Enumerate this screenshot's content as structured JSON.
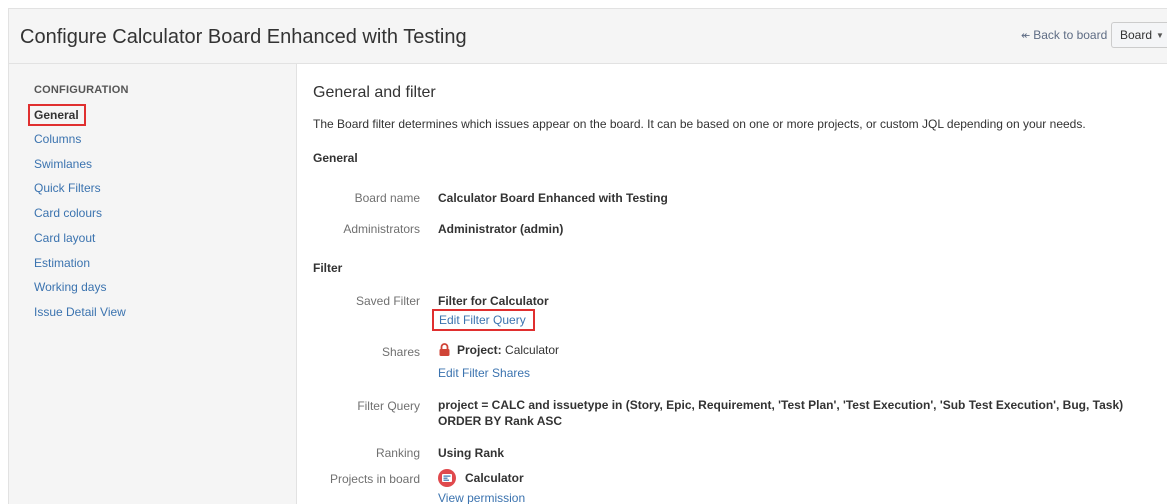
{
  "header": {
    "title": "Configure Calculator Board Enhanced with Testing",
    "back_link": "Back to board",
    "board_button": "Board"
  },
  "sidebar": {
    "heading": "CONFIGURATION",
    "items": [
      {
        "label": "General",
        "active": true
      },
      {
        "label": "Columns"
      },
      {
        "label": "Swimlanes"
      },
      {
        "label": "Quick Filters"
      },
      {
        "label": "Card colours"
      },
      {
        "label": "Card layout"
      },
      {
        "label": "Estimation"
      },
      {
        "label": "Working days"
      },
      {
        "label": "Issue Detail View"
      }
    ]
  },
  "main": {
    "title": "General and filter",
    "description": "The Board filter determines which issues appear on the board. It can be based on one or more projects, or custom JQL depending on your needs.",
    "general_heading": "General",
    "board_name_label": "Board name",
    "board_name_value": "Calculator Board Enhanced with Testing",
    "administrators_label": "Administrators",
    "administrators_value": "Administrator (admin)",
    "filter_heading": "Filter",
    "saved_filter_label": "Saved Filter",
    "saved_filter_value": "Filter for Calculator",
    "edit_filter_query": "Edit Filter Query",
    "shares_label": "Shares",
    "shares_prefix": "Project:",
    "shares_value": "Calculator",
    "edit_filter_shares": "Edit Filter Shares",
    "filter_query_label": "Filter Query",
    "filter_query_value": "project = CALC and issuetype in (Story, Epic, Requirement, 'Test Plan', 'Test Execution', 'Sub Test Execution', Bug, Task) ORDER BY Rank ASC",
    "ranking_label": "Ranking",
    "ranking_value": "Using Rank",
    "projects_label": "Projects in board",
    "projects_value": "Calculator",
    "view_permission": "View permission"
  },
  "colors": {
    "link": "#3b73af",
    "highlight": "#e02f2f",
    "lock": "#d04437",
    "project_avatar": "#e0494d"
  }
}
